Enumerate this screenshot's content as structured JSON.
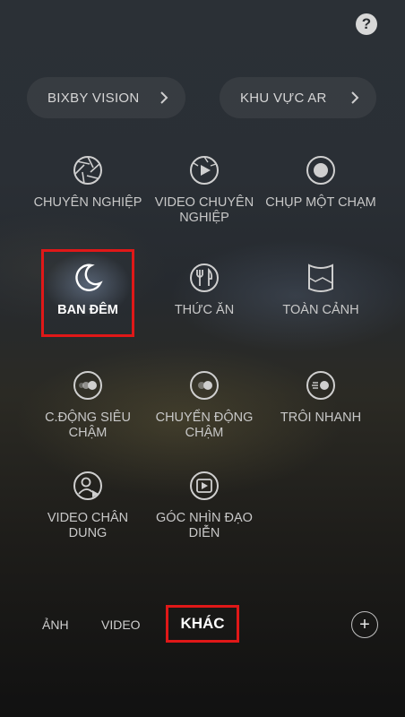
{
  "help_icon_label": "?",
  "pills": [
    {
      "label": "BIXBY VISION"
    },
    {
      "label": "KHU VỰC AR"
    }
  ],
  "modes": {
    "chuyen_nghiep": [
      "CHUYÊN NGHIỆP"
    ],
    "video_chuyen_nghiep": [
      "VIDEO CHUYÊN",
      "NGHIỆP"
    ],
    "chup_mot_cham": [
      "CHỤP MỘT CHẠM"
    ],
    "ban_dem": [
      "BAN ĐÊM"
    ],
    "thuc_an": [
      "THỨC ĂN"
    ],
    "toan_canh": [
      "TOÀN CẢNH"
    ],
    "c_dong_sieu_cham": [
      "C.ĐỘNG SIÊU",
      "CHẬM"
    ],
    "chuyen_dong_cham": [
      "CHUYỂN ĐỘNG",
      "CHẬM"
    ],
    "troi_nhanh": [
      "TRÔI NHANH"
    ],
    "video_chan_dung": [
      "VIDEO CHÂN",
      "DUNG"
    ],
    "goc_nhin_dao_dien": [
      "GÓC NHÌN ĐẠO",
      "DIỄN"
    ]
  },
  "bottom_tabs": {
    "anh": "ẢNH",
    "video": "VIDEO",
    "khac": "KHÁC",
    "plus": "+"
  },
  "colors": {
    "highlight": "#e01818"
  }
}
